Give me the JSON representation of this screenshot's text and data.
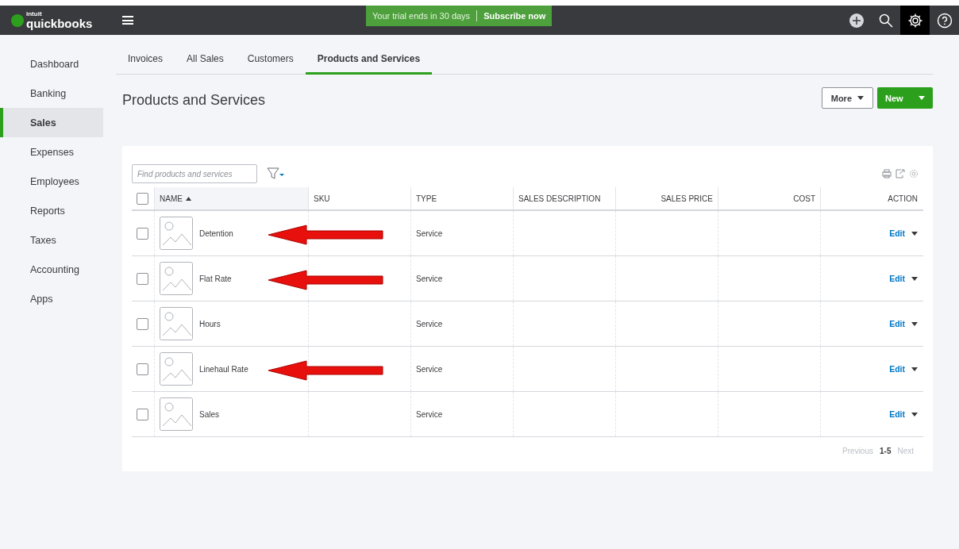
{
  "topbar": {
    "logo_small": "intuit",
    "logo": "quickbooks",
    "trial": "Your trial ends in 30 days",
    "subscribe": "Subscribe now"
  },
  "sidebar": {
    "items": [
      {
        "label": "Dashboard",
        "selected": false
      },
      {
        "label": "Banking",
        "selected": false
      },
      {
        "label": "Sales",
        "selected": true
      },
      {
        "label": "Expenses",
        "selected": false
      },
      {
        "label": "Employees",
        "selected": false
      },
      {
        "label": "Reports",
        "selected": false
      },
      {
        "label": "Taxes",
        "selected": false
      },
      {
        "label": "Accounting",
        "selected": false
      },
      {
        "label": "Apps",
        "selected": false
      }
    ]
  },
  "tabs": [
    {
      "label": "Invoices",
      "selected": false
    },
    {
      "label": "All Sales",
      "selected": false
    },
    {
      "label": "Customers",
      "selected": false
    },
    {
      "label": "Products and Services",
      "selected": true
    }
  ],
  "page_title": "Products and Services",
  "buttons": {
    "more": "More",
    "new": "New"
  },
  "search": {
    "placeholder": "Find products and services"
  },
  "table": {
    "select_all_checked": false,
    "columns": [
      {
        "label": "NAME",
        "right_aligned": false,
        "sorted": true
      },
      {
        "label": "SKU",
        "right_aligned": false,
        "sorted": false
      },
      {
        "label": "TYPE",
        "right_aligned": false,
        "sorted": false
      },
      {
        "label": "SALES DESCRIPTION",
        "right_aligned": false,
        "sorted": false
      },
      {
        "label": "SALES PRICE",
        "right_aligned": true,
        "sorted": false
      },
      {
        "label": "COST",
        "right_aligned": true,
        "sorted": false
      },
      {
        "label": "ACTION",
        "right_aligned": true,
        "sorted": false
      }
    ],
    "rows": [
      {
        "name": "Detention",
        "type": "Service",
        "action": "Edit",
        "checked": false,
        "arrow": true
      },
      {
        "name": "Flat Rate",
        "type": "Service",
        "action": "Edit",
        "checked": false,
        "arrow": true
      },
      {
        "name": "Hours",
        "type": "Service",
        "action": "Edit",
        "checked": false,
        "arrow": false
      },
      {
        "name": "Linehaul Rate",
        "type": "Service",
        "action": "Edit",
        "checked": false,
        "arrow": true
      },
      {
        "name": "Sales",
        "type": "Service",
        "action": "Edit",
        "checked": false,
        "arrow": false
      }
    ]
  },
  "pagination": {
    "previous": "Previous",
    "range": "1-5",
    "next": "Next"
  }
}
